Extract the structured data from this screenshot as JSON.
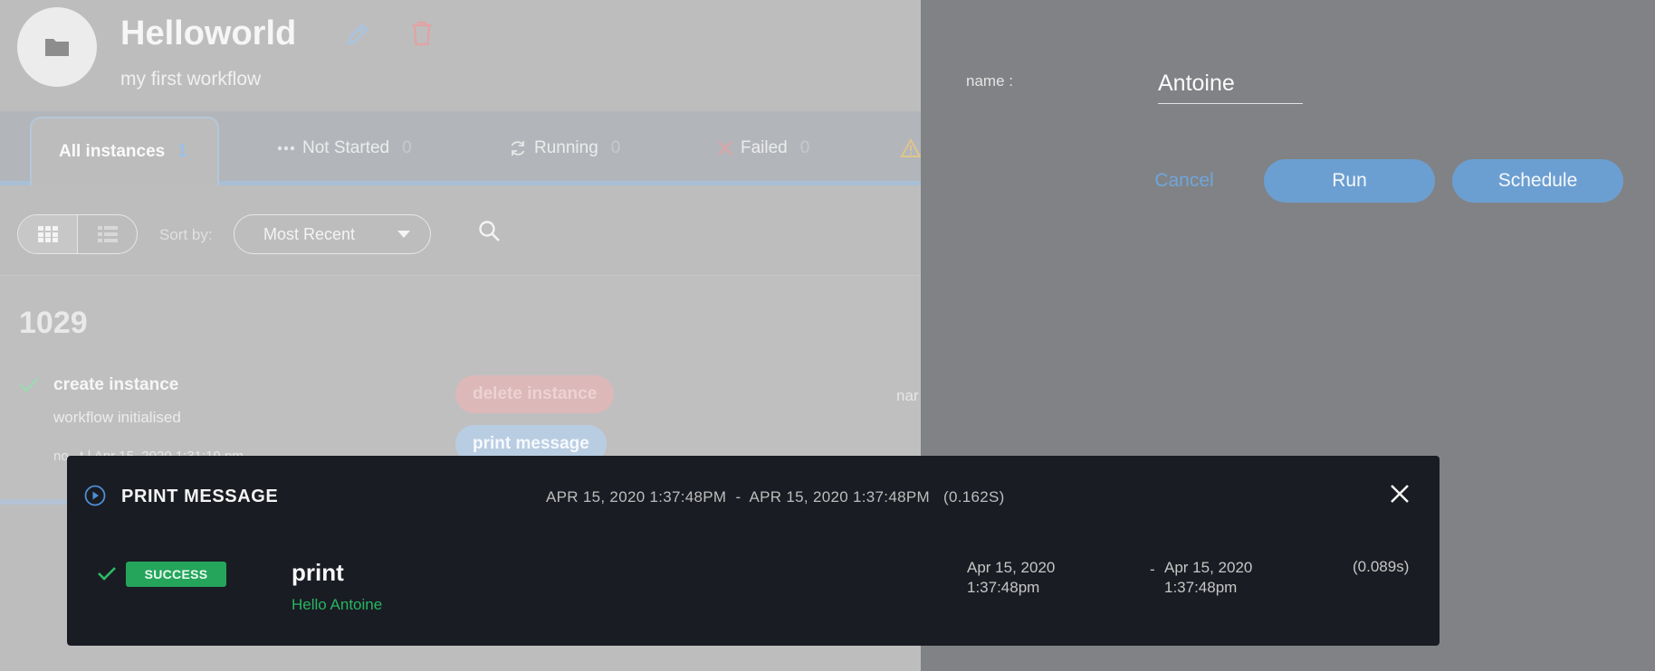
{
  "workflow": {
    "title": "Helloworld",
    "subtitle": "my first workflow"
  },
  "tabs": [
    {
      "label": "All instances",
      "count": "1"
    },
    {
      "label": "Not Started",
      "count": "0"
    },
    {
      "label": "Running",
      "count": "0"
    },
    {
      "label": "Failed",
      "count": "0"
    }
  ],
  "toolbar": {
    "sort_label": "Sort by:",
    "sort_value": "Most Recent"
  },
  "instance": {
    "id": "1029",
    "step_title": "create instance",
    "step_subtitle": "workflow initialised",
    "step_meta": "no...t  |  Apr 15, 2020 1:31:19 pm",
    "actions": [
      "delete instance",
      "print message"
    ],
    "side_text": "nar"
  },
  "drawer": {
    "param_label": "name :",
    "param_value": "Antoine",
    "cancel_label": "Cancel",
    "run_label": "Run",
    "schedule_label": "Schedule"
  },
  "modal": {
    "title": "PRINT MESSAGE",
    "start": "APR 15, 2020 1:37:48PM",
    "separator": "-",
    "end": "APR 15, 2020 1:37:48PM",
    "duration": "(0.162S)",
    "task": {
      "status": "SUCCESS",
      "name": "print",
      "output": "Hello Antoine",
      "start_date": "Apr 15, 2020",
      "start_time": "1:37:48pm",
      "separator": "-",
      "end_date": "Apr 15, 2020",
      "end_time": "1:37:48pm",
      "duration": "(0.089s)"
    }
  },
  "colors": {
    "accent_blue": "#6c9fd1",
    "success_green": "#25a55c",
    "modal_bg": "#1a1c23",
    "drawer_bg": "#818285"
  }
}
